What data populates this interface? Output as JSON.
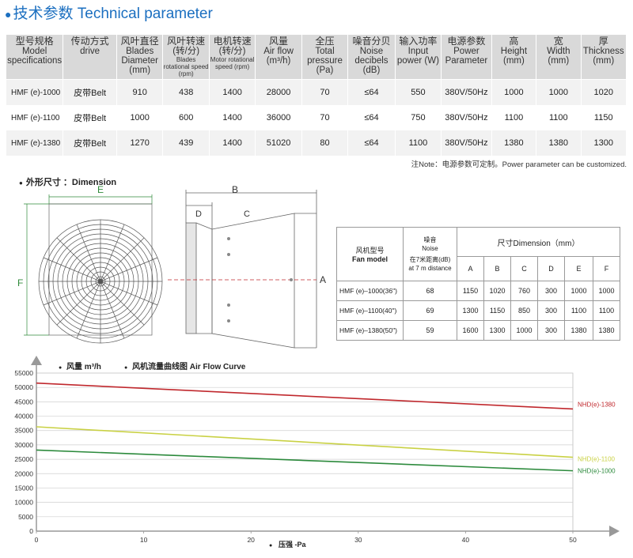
{
  "header": {
    "title": "技术参数 Technical parameter"
  },
  "spec_table": {
    "columns": [
      {
        "zh": "型号规格",
        "en": "Model specifications",
        "sub": ""
      },
      {
        "zh": "传动方式",
        "en": "drive",
        "sub": ""
      },
      {
        "zh": "风叶直径",
        "en": "Blades Diameter (mm)",
        "sub": ""
      },
      {
        "zh": "风叶转速",
        "en": "(转/分)",
        "sub": "Blades rotational speed (rpm)"
      },
      {
        "zh": "电机转速",
        "en": "(转/分)",
        "sub": "Motor rotational speed (rpm)"
      },
      {
        "zh": "风量",
        "en": "Air flow (m³/h)",
        "sub": ""
      },
      {
        "zh": "全压",
        "en": "Total pressure (Pa)",
        "sub": ""
      },
      {
        "zh": "噪音分贝",
        "en": "Noise decibels (dB)",
        "sub": ""
      },
      {
        "zh": "输入功率",
        "en": "Input power (W)",
        "sub": ""
      },
      {
        "zh": "电源参数",
        "en": "Power Parameter",
        "sub": ""
      },
      {
        "zh": "高",
        "en": "Height (mm)",
        "sub": ""
      },
      {
        "zh": "宽",
        "en": "Width (mm)",
        "sub": ""
      },
      {
        "zh": "厚",
        "en": "Thickness (mm)",
        "sub": ""
      }
    ],
    "rows": [
      [
        "HMF (e)-1000",
        "皮带Belt",
        "910",
        "438",
        "1400",
        "28000",
        "70",
        "≤64",
        "550",
        "380V/50Hz",
        "1000",
        "1000",
        "1020"
      ],
      [
        "HMF (e)-1100",
        "皮带Belt",
        "1000",
        "600",
        "1400",
        "36000",
        "70",
        "≤64",
        "750",
        "380V/50Hz",
        "1100",
        "1100",
        "1150"
      ],
      [
        "HMF (e)-1380",
        "皮带Belt",
        "1270",
        "439",
        "1400",
        "51020",
        "80",
        "≤64",
        "1100",
        "380V/50Hz",
        "1380",
        "1380",
        "1300"
      ]
    ]
  },
  "note": "注Note：电源参数可定制。Power parameter can be customized.",
  "dimension": {
    "title": "外形尺寸 ：Dimension",
    "labels": {
      "E": "E",
      "F": "F",
      "B": "B",
      "D": "D",
      "C": "C",
      "A": "A"
    }
  },
  "dimension_table": {
    "model_header_zh": "风机型号",
    "model_header_en": "Fan model",
    "noise_header_zh": "噪音",
    "noise_header_en": "Noise",
    "noise_sub_zh": "在7米距离(dB)",
    "noise_sub_en": "at 7 m distance",
    "size_header": "尺寸Dimension（mm）",
    "size_cols": [
      "A",
      "B",
      "C",
      "D",
      "E",
      "F"
    ],
    "rows": [
      {
        "model": "HMF (e)–1000(36\")",
        "noise": "68",
        "sizes": [
          "1150",
          "1020",
          "760",
          "300",
          "1000",
          "1000"
        ]
      },
      {
        "model": "HMF (e)–1100(40\")",
        "noise": "69",
        "sizes": [
          "1300",
          "1150",
          "850",
          "300",
          "1100",
          "1100"
        ]
      },
      {
        "model": "HMF (e)–1380(50\")",
        "noise": "59",
        "sizes": [
          "1600",
          "1300",
          "1000",
          "300",
          "1380",
          "1380"
        ]
      }
    ]
  },
  "chart_data": {
    "type": "line",
    "title": "风机流量曲线图  Air Flow Curve",
    "ylabel": "风量 m³/h",
    "xlabel": "压强  -Pa",
    "ylim": [
      0,
      55000
    ],
    "xlim": [
      0,
      50
    ],
    "yticks": [
      0,
      5000,
      10000,
      15000,
      20000,
      25000,
      30000,
      35000,
      40000,
      45000,
      50000,
      55000
    ],
    "xticks": [
      0,
      10,
      20,
      30,
      40,
      50
    ],
    "grid": true,
    "series": [
      {
        "name": "NHD(e)-1380",
        "color": "#c0282d",
        "x": [
          0,
          50
        ],
        "values": [
          51500,
          42500
        ]
      },
      {
        "name": "NHD(e)-1100",
        "color": "#c9d144",
        "x": [
          0,
          50
        ],
        "values": [
          36300,
          25700
        ]
      },
      {
        "name": "NHD(e)-1000",
        "color": "#2c8a3c",
        "x": [
          0,
          50
        ],
        "values": [
          28200,
          21000
        ]
      }
    ]
  }
}
